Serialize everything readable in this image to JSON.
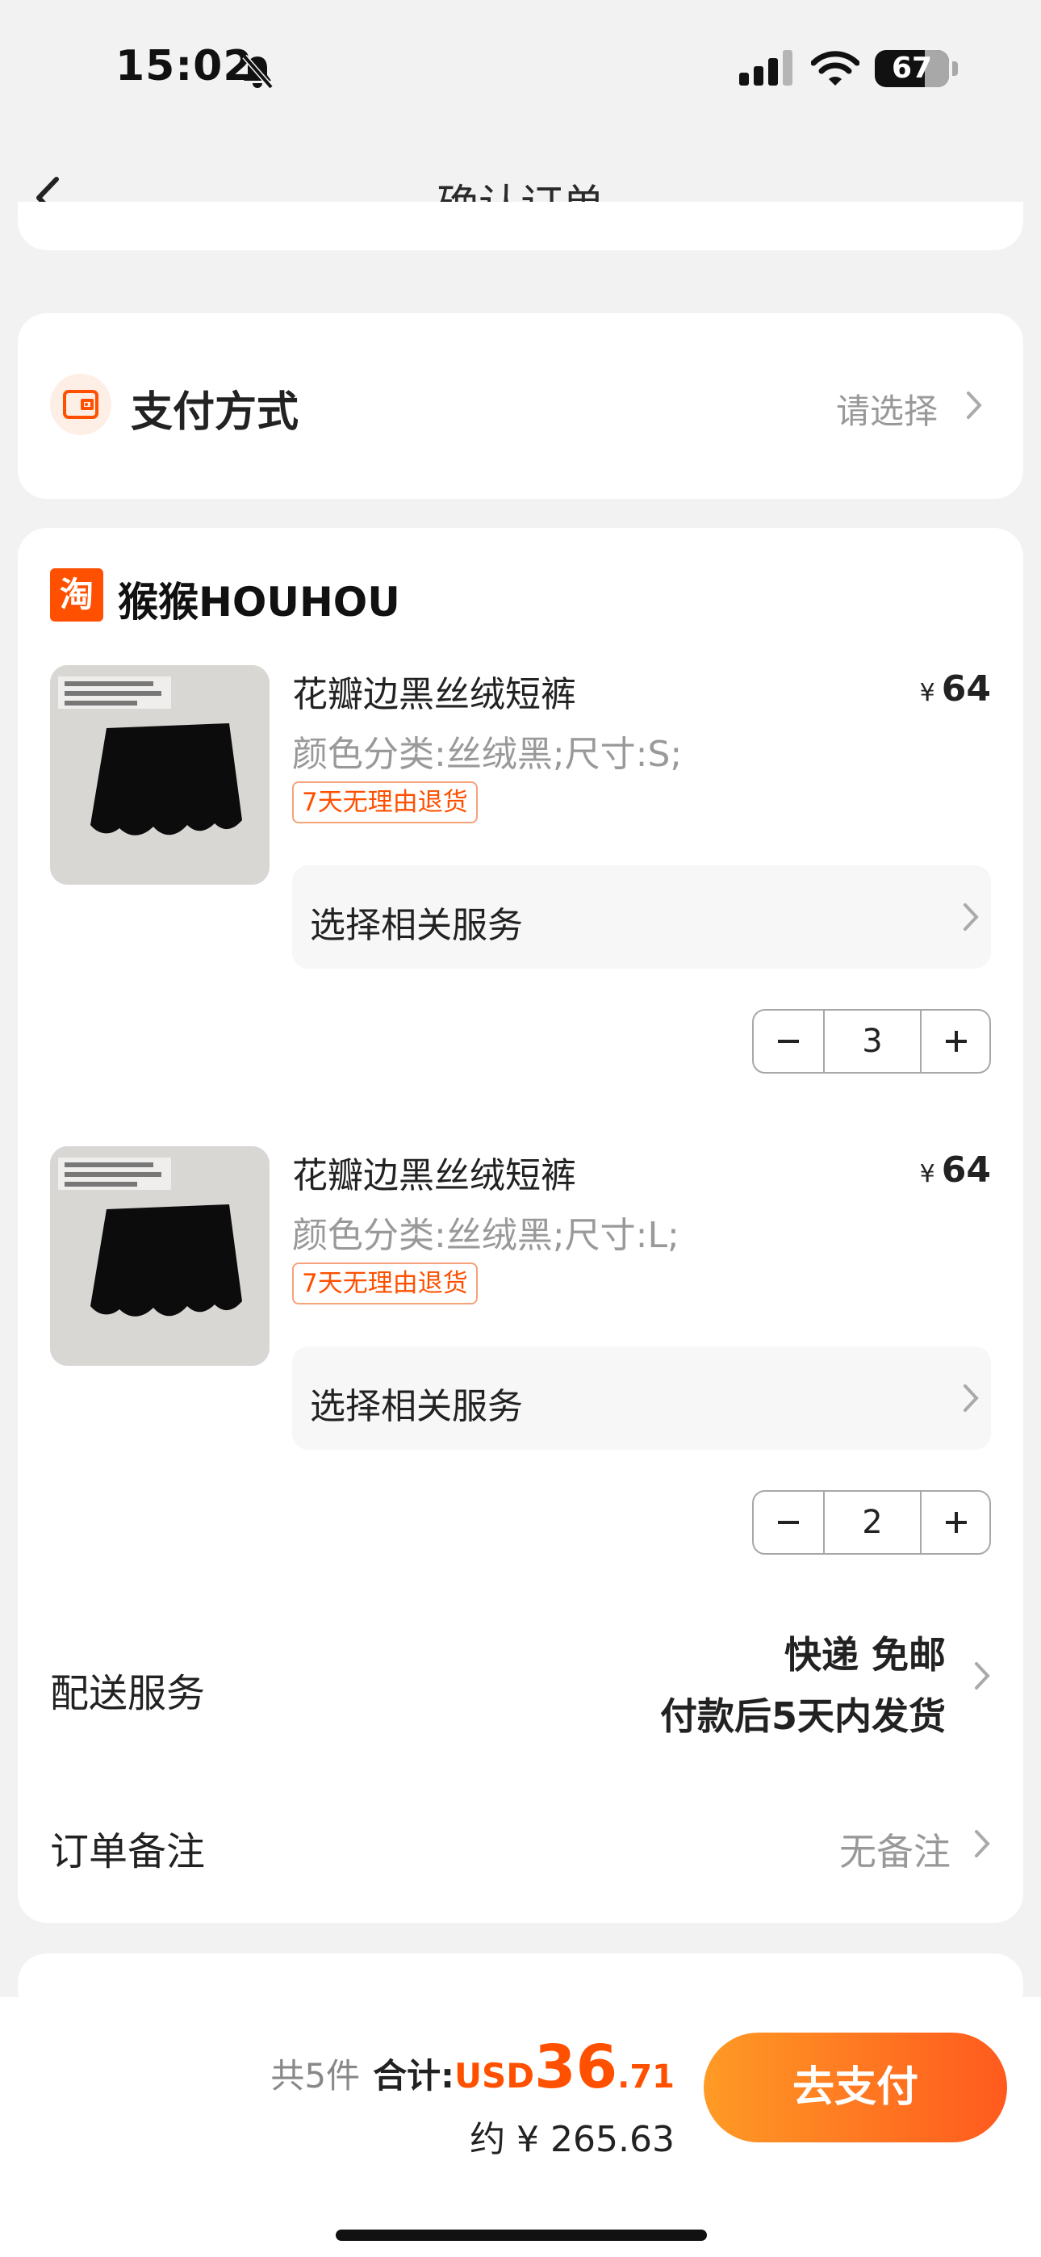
{
  "status_bar": {
    "time": "15:02",
    "battery": "67"
  },
  "nav": {
    "title": "确认订单"
  },
  "payment": {
    "label": "支付方式",
    "select_text": "请选择"
  },
  "shop": {
    "logo_char": "淘",
    "name": "猴猴HOUHOU",
    "items": [
      {
        "title": "花瓣边黑丝绒短裤",
        "price_symbol": "¥",
        "price": "64",
        "sku": "颜色分类:丝绒黑;尺寸:S;",
        "badge": "7天无理由退货",
        "service_label": "选择相关服务",
        "quantity": "3"
      },
      {
        "title": "花瓣边黑丝绒短裤",
        "price_symbol": "¥",
        "price": "64",
        "sku": "颜色分类:丝绒黑;尺寸:L;",
        "badge": "7天无理由退货",
        "service_label": "选择相关服务",
        "quantity": "2"
      }
    ]
  },
  "shipping": {
    "label": "配送服务",
    "line1": "快递 免邮",
    "line2": "付款后5天内发货"
  },
  "note": {
    "label": "订单备注",
    "value": "无备注"
  },
  "bottom": {
    "count": "共5件",
    "total_label": "合计:",
    "currency": "USD",
    "amount_int": "36",
    "amount_dec": ".71",
    "approx": "约 ¥ 265.63",
    "pay_button": "去支付"
  },
  "colors": {
    "accent": "#ff5000",
    "page_bg": "#f2f2f2",
    "button_gradient": [
      "#ff9a25",
      "#ff5a1e"
    ]
  }
}
